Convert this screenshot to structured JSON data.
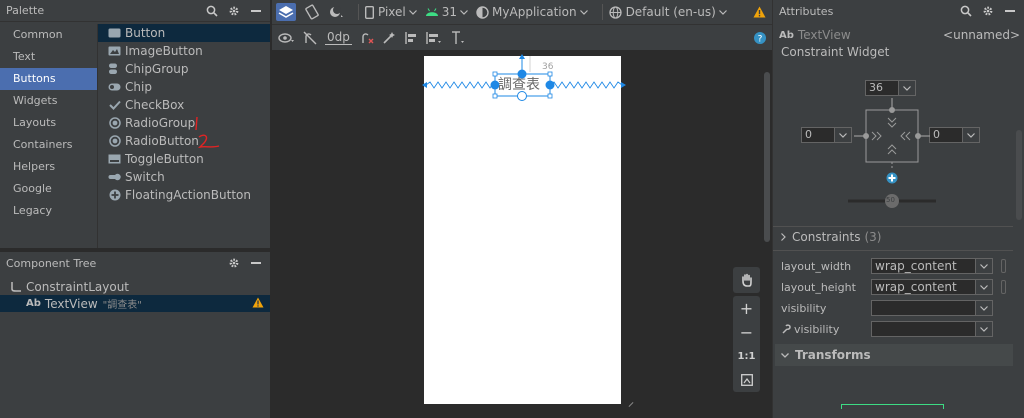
{
  "palette": {
    "title": "Palette",
    "categories": [
      "Common",
      "Text",
      "Buttons",
      "Widgets",
      "Layouts",
      "Containers",
      "Helpers",
      "Google",
      "Legacy"
    ],
    "selected_category": "Buttons",
    "components": [
      {
        "label": "Button",
        "icon": "button-icon"
      },
      {
        "label": "ImageButton",
        "icon": "image-button-icon"
      },
      {
        "label": "ChipGroup",
        "icon": "chip-group-icon"
      },
      {
        "label": "Chip",
        "icon": "chip-icon"
      },
      {
        "label": "CheckBox",
        "icon": "checkbox-icon"
      },
      {
        "label": "RadioGroup",
        "icon": "radio-group-icon"
      },
      {
        "label": "RadioButton",
        "icon": "radio-button-icon"
      },
      {
        "label": "ToggleButton",
        "icon": "toggle-button-icon"
      },
      {
        "label": "Switch",
        "icon": "switch-icon"
      },
      {
        "label": "FloatingActionButton",
        "icon": "fab-icon"
      }
    ],
    "annotations": [
      "1",
      "2"
    ]
  },
  "component_tree": {
    "title": "Component Tree",
    "root": "ConstraintLayout",
    "child_prefix": "Ab",
    "child": "TextView",
    "child_text": "\"調查表\""
  },
  "toolbar": {
    "device": "Pixel",
    "api": "31",
    "app": "MyApplication",
    "locale": "Default (en-us)",
    "margin": "0dp"
  },
  "design": {
    "textview_text": "調查表",
    "top_margin": "36"
  },
  "zoom": {
    "fit_label": "1:1"
  },
  "attributes": {
    "title": "Attributes",
    "prefix": "Ab",
    "type": "TextView",
    "id": "<unnamed>",
    "widget_title": "Constraint Widget",
    "top_margin": "36",
    "left_margin": "0",
    "right_margin": "0",
    "bias": "50",
    "constraints_label": "Constraints",
    "constraints_count": "(3)",
    "rows": [
      {
        "label": "layout_width",
        "value": "wrap_content"
      },
      {
        "label": "layout_height",
        "value": "wrap_content"
      },
      {
        "label": "visibility",
        "value": ""
      },
      {
        "label": "visibility",
        "value": ""
      }
    ],
    "transforms_label": "Transforms"
  },
  "colors": {
    "panel": "#3c3f41",
    "accent": "#4b6eaf",
    "blueprint": "#1e88e5",
    "warning": "#f0a30a"
  }
}
